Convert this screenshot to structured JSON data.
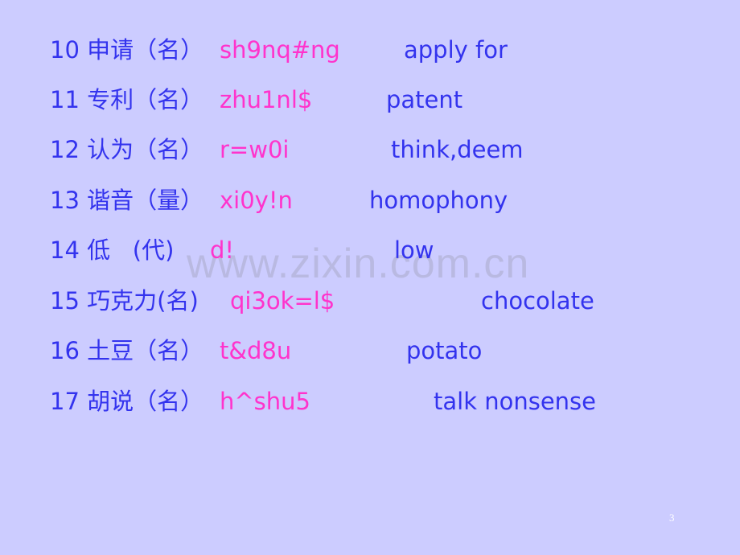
{
  "slide": {
    "page_number": "3",
    "watermark": "www.zixin.com.cn",
    "colors": {
      "background": "#ccccff",
      "term_text": "#3333ee",
      "pinyin_text": "#ff33cc",
      "meaning_text": "#3333ee"
    },
    "entries": [
      {
        "number": "10",
        "word": "申请",
        "pos": "（名）",
        "pinyin": "sh9nq#ng",
        "meaning": "apply for"
      },
      {
        "number": "11",
        "word": "专利",
        "pos": "（名）",
        "pinyin": "zhu1nl$",
        "meaning": "patent"
      },
      {
        "number": "12",
        "word": "认为",
        "pos": "（名）",
        "pinyin": "r=w0i",
        "meaning": "think,deem"
      },
      {
        "number": "13",
        "word": "谐音",
        "pos": "（量）",
        "pinyin": "xi0y!n",
        "meaning": "homophony"
      },
      {
        "number": "14",
        "word": "低",
        "pos": "   (代)",
        "pinyin": "d!",
        "meaning": "low"
      },
      {
        "number": "15",
        "word": "巧克力",
        "pos": "(名)",
        "pinyin": "qi3ok=l$",
        "meaning": "chocolate"
      },
      {
        "number": "16",
        "word": "土豆",
        "pos": "（名）",
        "pinyin": "t&d8u",
        "meaning": "potato"
      },
      {
        "number": "17",
        "word": "胡说",
        "pos": "（名）",
        "pinyin": "h^shu5",
        "meaning": "talk nonsense"
      }
    ]
  }
}
